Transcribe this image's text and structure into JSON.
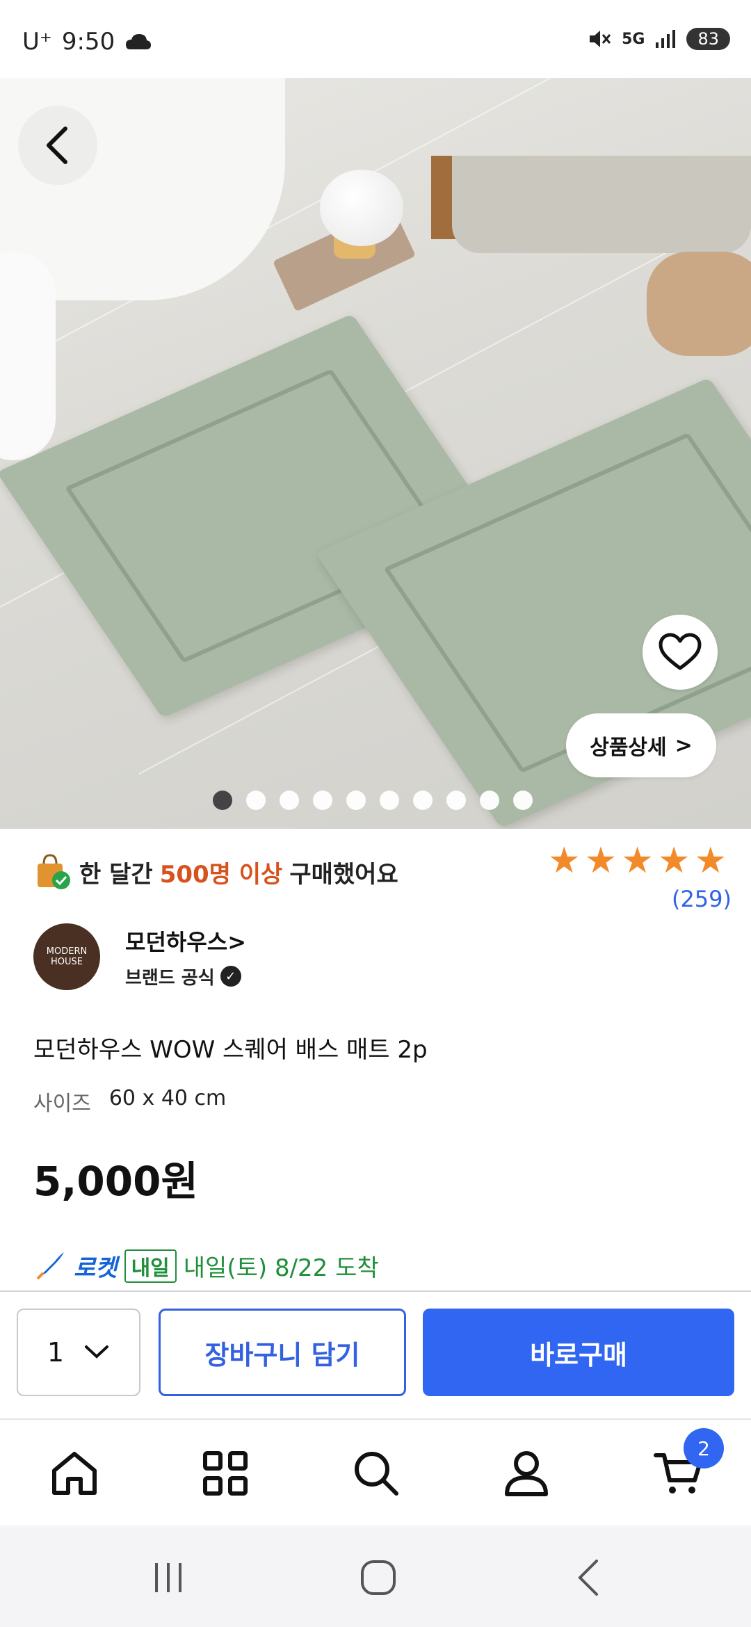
{
  "status": {
    "carrier": "U⁺",
    "time": "9:50",
    "network": "5G",
    "battery": "83"
  },
  "hero": {
    "slide_count": 10,
    "active_slide": 0,
    "detail_label": "상품상세",
    "detail_chevron": ">"
  },
  "product": {
    "sold_prefix": "한 달간",
    "sold_highlight": "500명 이상",
    "sold_suffix": "구매했어요",
    "rating": 5,
    "review_count": "(259)",
    "brand_logo_text": "MODERN HOUSE",
    "brand_name": "모던하우스>",
    "brand_sub": "브랜드 공식",
    "title": "모던하우스 WOW 스퀘어 배스 매트 2p",
    "size_label": "사이즈",
    "size_value": "60 x 40 cm",
    "price": "5,000원",
    "delivery_brand": "로켓",
    "delivery_badge": "내일",
    "delivery_text": "내일(토) 8/22 도착"
  },
  "buybar": {
    "quantity": "1",
    "cart_label": "장바구니 담기",
    "buy_label": "바로구매"
  },
  "tabbar": {
    "cart_count": "2",
    "icons": [
      "home-icon",
      "category-icon",
      "search-icon",
      "profile-icon",
      "cart-icon"
    ]
  },
  "colors": {
    "accent_blue": "#3166f2",
    "highlight_orange": "#d7521c",
    "star_orange": "#f28a2a",
    "delivery_green": "#1f8f3a"
  }
}
